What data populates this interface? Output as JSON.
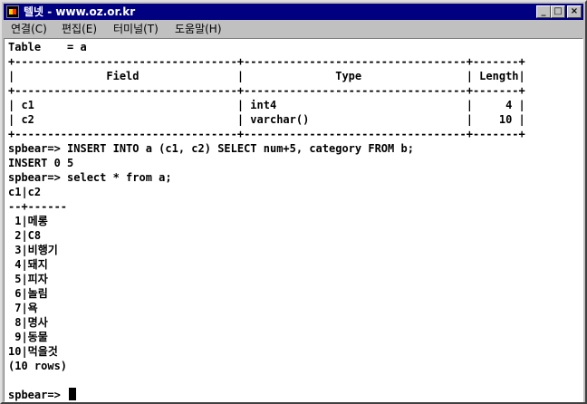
{
  "window": {
    "title": "텔넷 - www.oz.or.kr",
    "controls": {
      "minimize": "_",
      "maximize": "□",
      "close": "×"
    }
  },
  "menu": [
    "연결(C)",
    "편집(E)",
    "터미널(T)",
    "도움말(H)"
  ],
  "terminal": {
    "lines": [
      "Table    = a",
      "+----------------------------------+----------------------------------+-------+",
      "|              Field               |              Type                | Length|",
      "+----------------------------------+----------------------------------+-------+",
      "| c1                               | int4                             |     4 |",
      "| c2                               | varchar()                        |    10 |",
      "+----------------------------------+----------------------------------+-------+",
      "spbear=> INSERT INTO a (c1, c2) SELECT num+5, category FROM b;",
      "INSERT 0 5",
      "spbear=> select * from a;",
      "c1|c2",
      "--+------",
      " 1|메롱",
      " 2|C8",
      " 3|비행기",
      " 4|돼지",
      " 5|피자",
      " 6|놀림",
      " 7|욕",
      " 8|명사",
      " 9|동물",
      "10|먹을것",
      "(10 rows)",
      ""
    ],
    "prompt": "spbear=> "
  }
}
